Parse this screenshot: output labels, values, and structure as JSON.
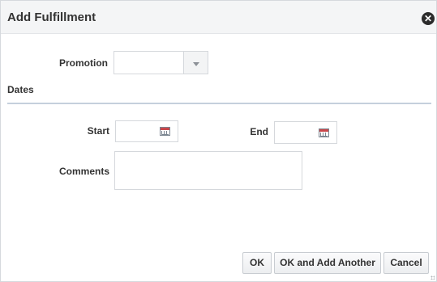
{
  "dialog": {
    "title": "Add Fulfillment",
    "close_icon": "close-icon",
    "close_glyph": "✕"
  },
  "form": {
    "promotion": {
      "label": "Promotion",
      "value": ""
    },
    "dates_section": {
      "title": "Dates"
    },
    "start": {
      "label": "Start",
      "value": "",
      "icon": "calendar-icon"
    },
    "end": {
      "label": "End",
      "value": "",
      "icon": "calendar-icon"
    },
    "comments": {
      "label": "Comments",
      "value": ""
    }
  },
  "buttons": {
    "ok_label": "OK",
    "ok_and_add_another_label": "OK and Add Another",
    "cancel_label": "Cancel"
  }
}
